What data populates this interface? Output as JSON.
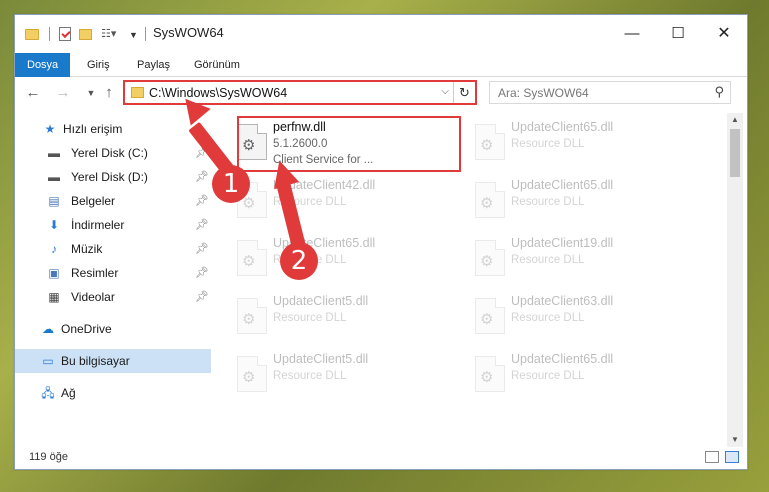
{
  "window": {
    "title": "SysWOW64",
    "controls": {
      "minimize": "—",
      "maximize": "☐",
      "close": "✕"
    }
  },
  "ribbon": {
    "tabs": [
      "Dosya",
      "Giriş",
      "Paylaş",
      "Görünüm"
    ],
    "active_tab": "Dosya"
  },
  "address": {
    "path": "C:\\Windows\\SysWOW64"
  },
  "search": {
    "placeholder": "Ara: SysWOW64"
  },
  "sidebar": {
    "items": [
      {
        "label": "Hızlı erişim",
        "icon": "star-icon",
        "pinned": false
      },
      {
        "label": "Yerel Disk (C:)",
        "icon": "drive-icon",
        "pinned": true
      },
      {
        "label": "Yerel Disk (D:)",
        "icon": "drive-icon",
        "pinned": true
      },
      {
        "label": "Belgeler",
        "icon": "documents-icon",
        "pinned": true
      },
      {
        "label": "İndirmeler",
        "icon": "download-icon",
        "pinned": true
      },
      {
        "label": "Müzik",
        "icon": "music-icon",
        "pinned": true
      },
      {
        "label": "Resimler",
        "icon": "pictures-icon",
        "pinned": true
      },
      {
        "label": "Videolar",
        "icon": "videos-icon",
        "pinned": true
      },
      {
        "label": "OneDrive",
        "icon": "cloud-icon",
        "pinned": false
      },
      {
        "label": "Bu bilgisayar",
        "icon": "computer-icon",
        "pinned": false
      },
      {
        "label": "Ağ",
        "icon": "network-icon",
        "pinned": false
      }
    ],
    "selected": "Bu bilgisayar"
  },
  "files": [
    {
      "name": "UpdateClient65.dll",
      "type": "Resource DLL"
    },
    {
      "name": "perfnw.dll",
      "version": "5.1.2600.0",
      "description": "Client Service for ..."
    },
    {
      "name": "UpdateClient42.dll",
      "type": "Resource DLL"
    },
    {
      "name": "UpdateClient65.dll",
      "type": "Resource DLL"
    },
    {
      "name": "UpdateClient65.dll",
      "type": "Resource DLL"
    },
    {
      "name": "UpdateClient19.dll",
      "type": "Resource DLL"
    },
    {
      "name": "UpdateClient5.dll",
      "type": "Resource DLL"
    },
    {
      "name": "UpdateClient63.dll",
      "type": "Resource DLL"
    },
    {
      "name": "UpdateClient5.dll",
      "type": "Resource DLL"
    },
    {
      "name": "UpdateClient65.dll",
      "type": "Resource DLL"
    }
  ],
  "status": {
    "count": "119 öğe"
  },
  "annotations": {
    "badge1": "1",
    "badge2": "2"
  },
  "colors": {
    "accent": "#1979ca",
    "highlight": "#e03a3a",
    "selected": "#cce1f5"
  }
}
